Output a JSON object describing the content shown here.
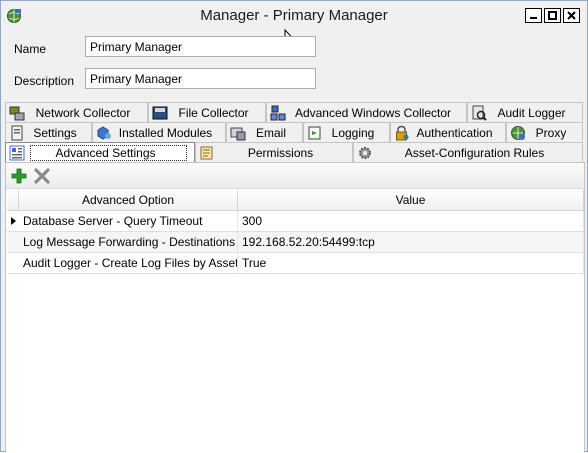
{
  "window": {
    "title": "Manager - Primary Manager",
    "icon": "manager-globe-icon"
  },
  "form": {
    "name_label": "Name",
    "name_value": "Primary Manager",
    "description_label": "Description",
    "description_value": "Primary Manager"
  },
  "tabs": {
    "row1": [
      {
        "label": "Network Collector",
        "icon": "network-collector-icon"
      },
      {
        "label": "File Collector",
        "icon": "file-collector-icon"
      },
      {
        "label": "Advanced Windows Collector",
        "icon": "windows-collector-icon"
      },
      {
        "label": "Audit Logger",
        "icon": "audit-logger-icon"
      }
    ],
    "row2": [
      {
        "label": "Settings",
        "icon": "settings-icon"
      },
      {
        "label": "Installed Modules",
        "icon": "modules-icon"
      },
      {
        "label": "Email",
        "icon": "email-icon"
      },
      {
        "label": "Logging",
        "icon": "logging-icon"
      },
      {
        "label": "Authentication",
        "icon": "lock-icon"
      },
      {
        "label": "Proxy",
        "icon": "proxy-icon"
      }
    ],
    "row3": [
      {
        "label": "Advanced Settings",
        "icon": "advanced-settings-icon",
        "active": true
      },
      {
        "label": "Permissions",
        "icon": "permissions-icon"
      },
      {
        "label": "Asset-Configuration Rules",
        "icon": "gear-icon"
      }
    ]
  },
  "toolbar": {
    "add_icon": "add-icon",
    "remove_icon": "remove-icon"
  },
  "grid": {
    "columns": [
      "Advanced Option",
      "Value"
    ],
    "rows": [
      {
        "option": "Database Server - Query Timeout",
        "value": "300",
        "selected": true
      },
      {
        "option": "Log Message Forwarding - Destinations",
        "value": "192.168.52.20:54499:tcp"
      },
      {
        "option": "Audit Logger - Create Log Files by Asset",
        "value": "True"
      }
    ]
  },
  "colors": {
    "window_bg": "#f0f0f0",
    "add_green": "#2e9a2e",
    "remove_gray": "#8a8a8a"
  }
}
